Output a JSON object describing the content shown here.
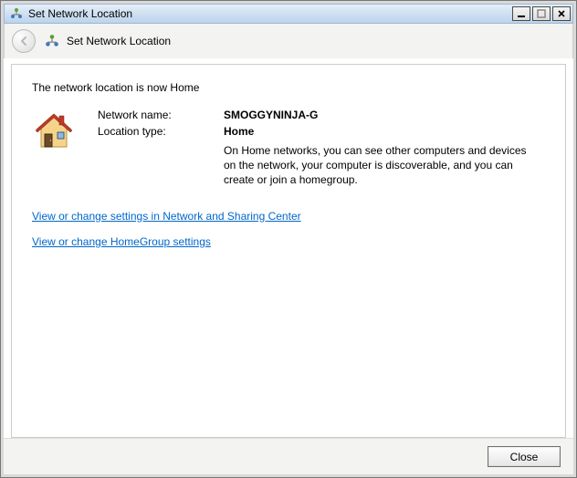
{
  "window": {
    "title": "Set Network Location"
  },
  "header": {
    "title": "Set Network Location"
  },
  "content": {
    "heading": "The network location is now Home",
    "network_name_label": "Network name:",
    "network_name_value": "SMOGGYNINJA-G",
    "location_type_label": "Location type:",
    "location_type_value": "Home",
    "description": "On Home networks, you can see other computers and devices on the network, your computer is discoverable, and you can create or join a homegroup."
  },
  "links": {
    "network_sharing": "View or change settings in Network and Sharing Center",
    "homegroup": "View or change HomeGroup settings"
  },
  "footer": {
    "close_label": "Close"
  }
}
